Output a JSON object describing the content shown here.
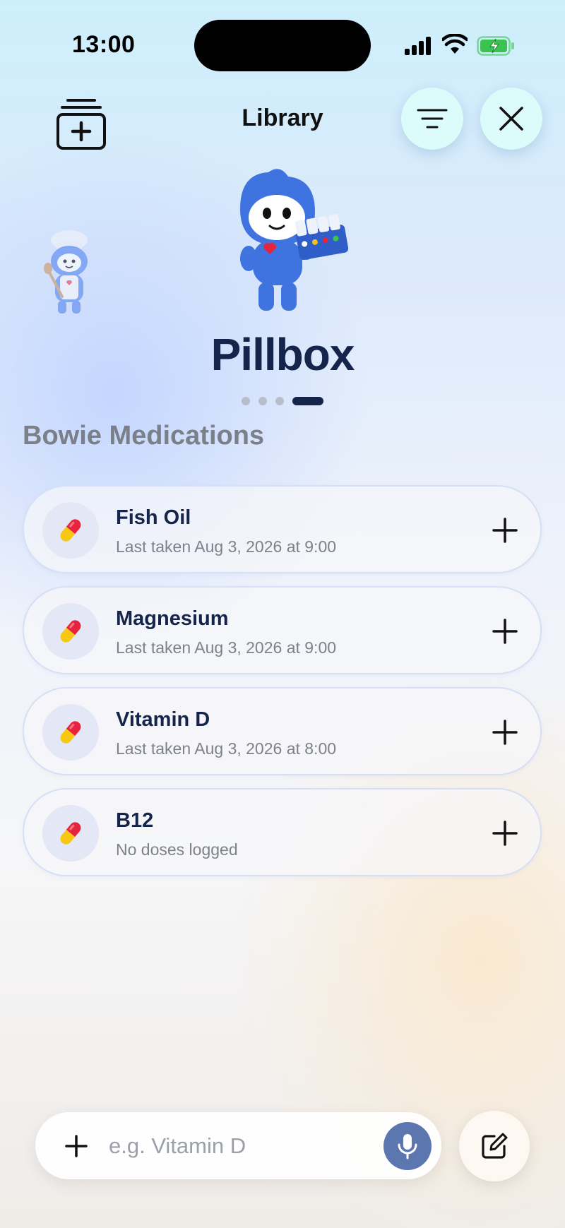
{
  "status_bar": {
    "time": "13:00",
    "signal_icon": "cellular-signal-icon",
    "wifi_icon": "wifi-icon",
    "battery_icon": "battery-charging-icon",
    "battery_color": "#3ac44f"
  },
  "header": {
    "title": "Library",
    "add_icon": "add-to-library-icon",
    "filter_icon": "filter-icon",
    "close_icon": "close-icon",
    "button_bg": "#dcfcfb"
  },
  "hero": {
    "title": "Pillbox",
    "pager": {
      "total": 4,
      "active_index": 3
    },
    "mascot_main": "pillbox-mascot",
    "mascot_side": "chef-mascot"
  },
  "section": {
    "title": "Bowie Medications"
  },
  "medications": [
    {
      "name": "Fish Oil",
      "status": "Last taken Aug 3, 2026 at 9:00",
      "icon": "pill-icon"
    },
    {
      "name": "Magnesium",
      "status": "Last taken Aug 3, 2026 at 9:00",
      "icon": "pill-icon"
    },
    {
      "name": "Vitamin D",
      "status": "Last taken Aug 3, 2026 at 8:00",
      "icon": "pill-icon"
    },
    {
      "name": "B12",
      "status": "No doses logged",
      "icon": "pill-icon"
    }
  ],
  "input": {
    "placeholder": "e.g. Vitamin D",
    "value": "",
    "plus_icon": "plus-icon",
    "mic_icon": "microphone-icon",
    "compose_icon": "compose-icon",
    "mic_color": "#5c77b0"
  },
  "colors": {
    "primary_text": "#14244a",
    "secondary_text": "#7d8189"
  }
}
